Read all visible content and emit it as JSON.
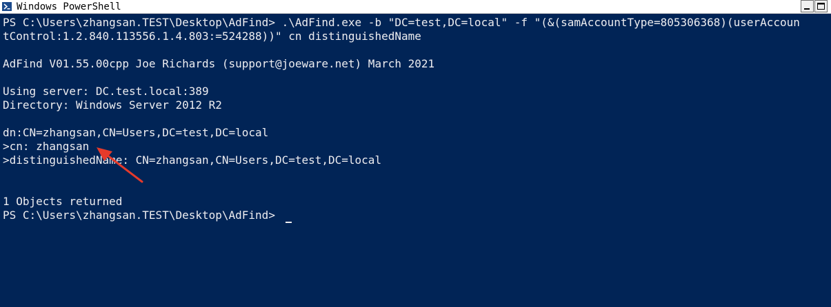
{
  "window": {
    "title": "Windows PowerShell",
    "icon": "powershell-icon",
    "background": "#012456",
    "foreground": "#eeedf0"
  },
  "console": {
    "lines": [
      "PS C:\\Users\\zhangsan.TEST\\Desktop\\AdFind> .\\AdFind.exe -b \"DC=test,DC=local\" -f \"(&(samAccountType=805306368)(userAccoun",
      "tControl:1.2.840.113556.1.4.803:=524288))\" cn distinguishedName",
      "",
      "AdFind V01.55.00cpp Joe Richards (support@joeware.net) March 2021",
      "",
      "Using server: DC.test.local:389",
      "Directory: Windows Server 2012 R2",
      "",
      "dn:CN=zhangsan,CN=Users,DC=test,DC=local",
      ">cn: zhangsan",
      ">distinguishedName: CN=zhangsan,CN=Users,DC=test,DC=local",
      "",
      "",
      "1 Objects returned",
      "PS C:\\Users\\zhangsan.TEST\\Desktop\\AdFind>"
    ]
  },
  "annotation": {
    "type": "arrow",
    "color": "#e53a2b",
    "points_to": ">cn: zhangsan"
  }
}
